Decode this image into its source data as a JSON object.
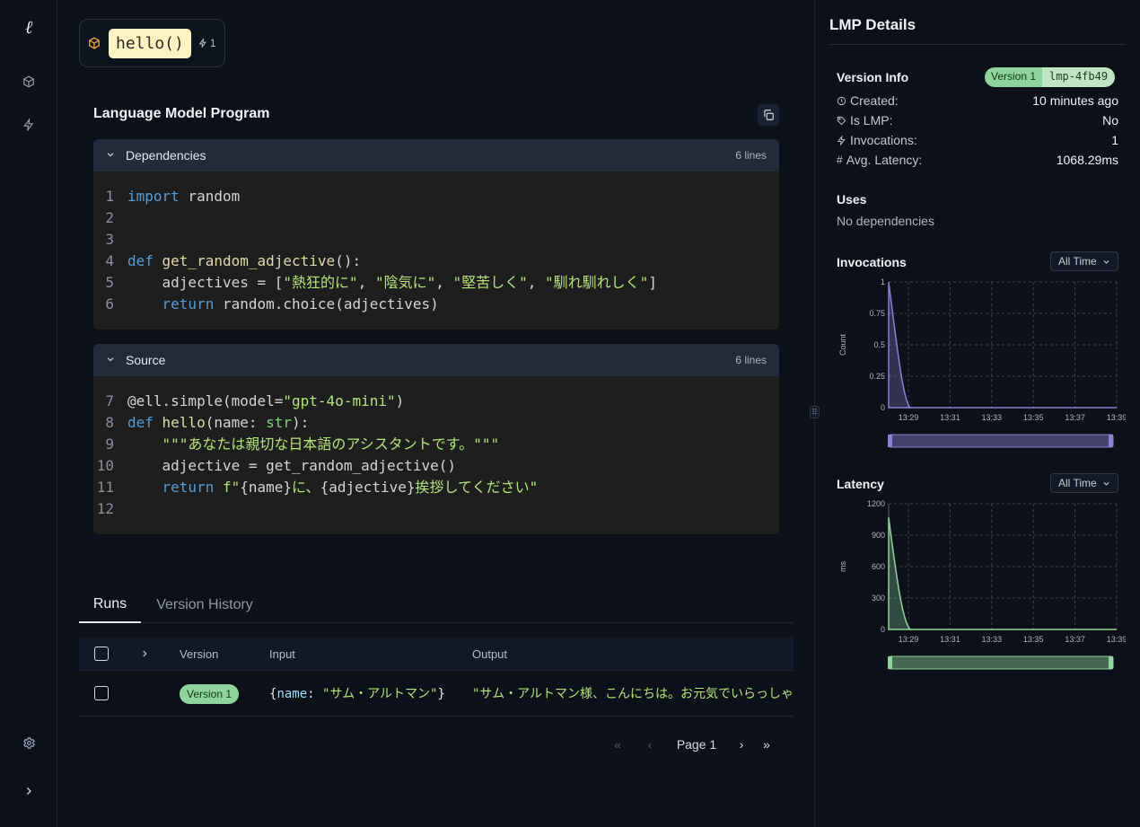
{
  "rail": {
    "logo": "ℓ"
  },
  "lmp": {
    "name": "hello()",
    "invocations": "1"
  },
  "section_title": "Language Model Program",
  "dependencies": {
    "label": "Dependencies",
    "lines_label": "6 lines",
    "lines": [
      {
        "n": "1",
        "tokens": [
          {
            "t": "import",
            "c": "kw"
          },
          {
            "t": " random",
            "c": ""
          }
        ]
      },
      {
        "n": "2",
        "tokens": []
      },
      {
        "n": "3",
        "tokens": []
      },
      {
        "n": "4",
        "tokens": [
          {
            "t": "def ",
            "c": "kw"
          },
          {
            "t": "get_random_adjective",
            "c": "fn"
          },
          {
            "t": "():",
            "c": ""
          }
        ]
      },
      {
        "n": "5",
        "tokens": [
          {
            "t": "    adjectives = [",
            "c": ""
          },
          {
            "t": "\"熱狂的に\"",
            "c": "st"
          },
          {
            "t": ", ",
            "c": ""
          },
          {
            "t": "\"陰気に\"",
            "c": "st"
          },
          {
            "t": ", ",
            "c": ""
          },
          {
            "t": "\"堅苦しく\"",
            "c": "st"
          },
          {
            "t": ", ",
            "c": ""
          },
          {
            "t": "\"馴れ馴れしく\"",
            "c": "st"
          },
          {
            "t": "]",
            "c": ""
          }
        ]
      },
      {
        "n": "6",
        "tokens": [
          {
            "t": "    ",
            "c": ""
          },
          {
            "t": "return",
            "c": "kw"
          },
          {
            "t": " random.choice(adjectives)",
            "c": ""
          }
        ]
      }
    ]
  },
  "source": {
    "label": "Source",
    "lines_label": "6 lines",
    "lines": [
      {
        "n": "7",
        "tokens": [
          {
            "t": "@ell.simple(model=",
            "c": ""
          },
          {
            "t": "\"gpt-4o-mini\"",
            "c": "st"
          },
          {
            "t": ")",
            "c": ""
          }
        ]
      },
      {
        "n": "8",
        "tokens": [
          {
            "t": "def ",
            "c": "kw"
          },
          {
            "t": "hello",
            "c": "fn"
          },
          {
            "t": "(name: ",
            "c": ""
          },
          {
            "t": "str",
            "c": "ty"
          },
          {
            "t": "):",
            "c": ""
          }
        ]
      },
      {
        "n": "9",
        "tokens": [
          {
            "t": "    ",
            "c": ""
          },
          {
            "t": "\"\"\"あなたは親切な日本語のアシスタントです。\"\"\"",
            "c": "st"
          }
        ]
      },
      {
        "n": "10",
        "tokens": [
          {
            "t": "    adjective = get_random_adjective()",
            "c": ""
          }
        ]
      },
      {
        "n": "11",
        "tokens": [
          {
            "t": "    ",
            "c": ""
          },
          {
            "t": "return",
            "c": "kw"
          },
          {
            "t": " ",
            "c": ""
          },
          {
            "t": "f\"",
            "c": "st"
          },
          {
            "t": "{name}",
            "c": ""
          },
          {
            "t": "に、",
            "c": "st"
          },
          {
            "t": "{adjective}",
            "c": ""
          },
          {
            "t": "挨拶してください\"",
            "c": "st"
          }
        ]
      },
      {
        "n": "12",
        "tokens": []
      }
    ]
  },
  "tabs": [
    {
      "label": "Runs",
      "active": true
    },
    {
      "label": "Version History",
      "active": false
    }
  ],
  "table": {
    "headers": {
      "version": "Version",
      "input": "Input",
      "output": "Output"
    },
    "rows": [
      {
        "version": "Version 1",
        "input_key": "name",
        "input_value": "\"サム・アルトマン\"",
        "output": "\"サム・アルトマン様、こんにちは。お元気でいらっしゃ"
      }
    ]
  },
  "pager": {
    "page_label": "Page 1"
  },
  "details": {
    "title": "LMP Details",
    "version_info_label": "Version Info",
    "version_badge": "Version 1",
    "version_hash": "lmp-4fb49",
    "created_label": "Created:",
    "created_value": "10 minutes ago",
    "is_lmp_label": "Is LMP:",
    "is_lmp_value": "No",
    "invocations_label": "Invocations:",
    "invocations_value": "1",
    "latency_label": "Avg. Latency:",
    "latency_value": "1068.29ms",
    "uses_label": "Uses",
    "uses_value": "No dependencies",
    "time_filter": "All Time"
  },
  "chart_data": [
    {
      "type": "area",
      "title": "Invocations",
      "ylabel": "Count",
      "ylim": [
        0,
        1
      ],
      "yticks": [
        "1",
        "0.75",
        "0.5",
        "0.25",
        "0"
      ],
      "xticks": [
        "13:29",
        "13:31",
        "13:33",
        "13:35",
        "13:37",
        "13:39"
      ],
      "series": [
        {
          "x": [
            "13:28",
            "13:29"
          ],
          "values": [
            1,
            0
          ]
        }
      ],
      "color": "#8b7fd6"
    },
    {
      "type": "area",
      "title": "Latency",
      "ylabel": "ms",
      "ylim": [
        0,
        1200
      ],
      "yticks": [
        "1200",
        "900",
        "600",
        "300",
        "0"
      ],
      "xticks": [
        "13:29",
        "13:31",
        "13:33",
        "13:35",
        "13:37",
        "13:39"
      ],
      "series": [
        {
          "x": [
            "13:28",
            "13:29"
          ],
          "values": [
            1068.29,
            0
          ]
        }
      ],
      "color": "#8fd49b"
    }
  ]
}
